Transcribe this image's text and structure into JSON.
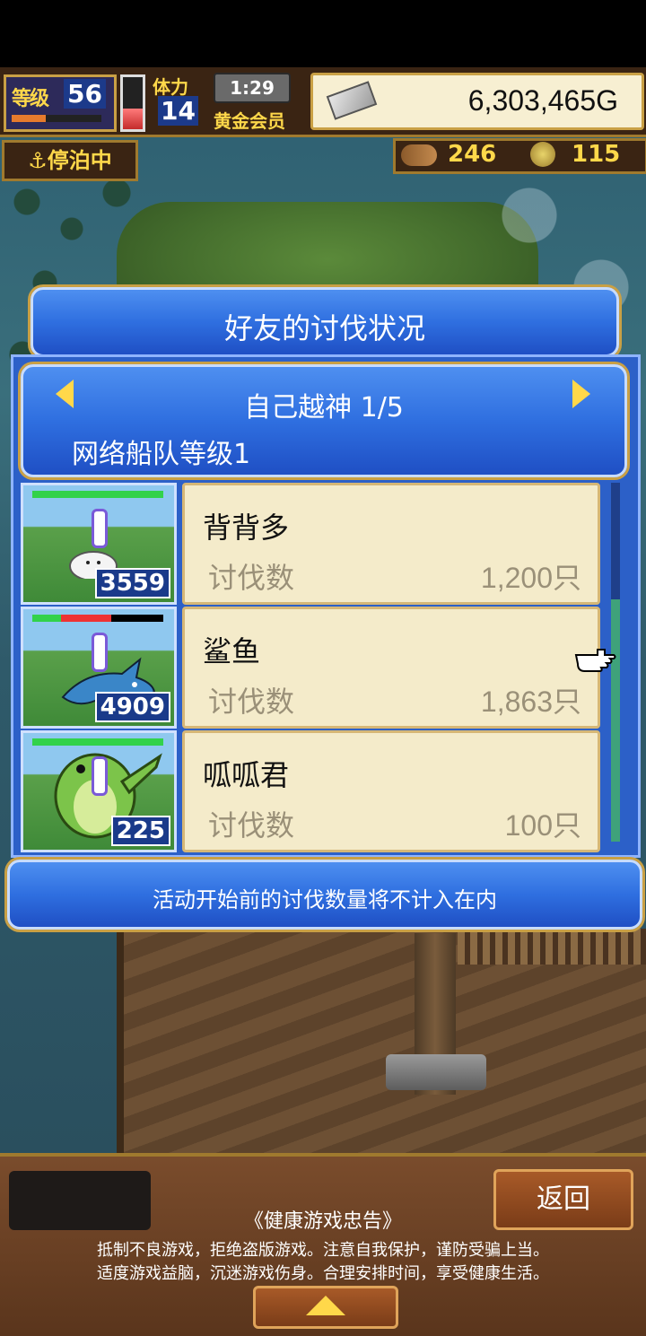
{
  "hud": {
    "level_label": "等级",
    "level": "56",
    "exp_progress": 0.38,
    "stamina_label": "体力",
    "stamina": "14",
    "stamina_fill": 0.4,
    "timer": "1:29",
    "membership": "黄金会员",
    "money": "6,303,465G",
    "status": "停泊中",
    "wood": "246",
    "coins": "115"
  },
  "dialog": {
    "title": "好友的讨伐状况",
    "boss": "自己越神 1/5",
    "fleet_level": "网络船队等级1",
    "notice": "活动开始前的讨伐数量将不计入在内",
    "kill_label": "讨伐数",
    "rows": [
      {
        "name": "背背多",
        "kills": "1,200只",
        "monster_level": "3559",
        "hp_green": 1.0,
        "hp_red": 0.0,
        "monster": "white-blob"
      },
      {
        "name": "鲨鱼",
        "kills": "1,863只",
        "monster_level": "4909",
        "hp_green": 0.22,
        "hp_red": 0.38,
        "monster": "blue-shark"
      },
      {
        "name": "呱呱君",
        "kills": "100只",
        "monster_level": "225",
        "hp_green": 1.0,
        "hp_red": 0.0,
        "monster": "green-frog"
      }
    ]
  },
  "footer": {
    "back_label": "返回",
    "advisory_title": "《健康游戏忠告》",
    "advisory_line1": "抵制不良游戏，拒绝盗版游戏。注意自我保护，谨防受骗上当。",
    "advisory_line2": "适度游戏益脑，沉迷游戏伤身。合理安排时间，享受健康生活。"
  }
}
